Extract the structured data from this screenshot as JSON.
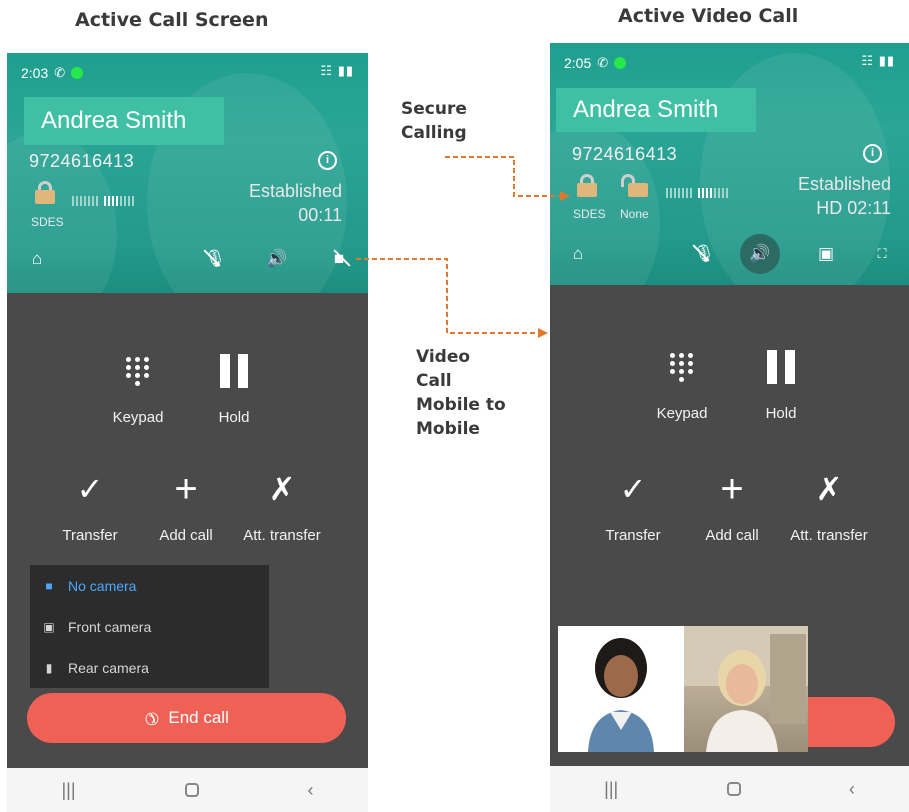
{
  "captions": {
    "left": "Active Call Screen",
    "right": "Active Video Call"
  },
  "annotations": {
    "secure": [
      "Secure",
      "Calling"
    ],
    "video": [
      "Video",
      "Call",
      "Mobile to",
      "Mobile"
    ]
  },
  "colors": {
    "header_teal": "#239a8b",
    "name_box": "#3fbfa3",
    "body_gray": "#4a4a4a",
    "end_call": "#f06155",
    "arrow": "#e07a2a",
    "menu_active": "#4aa8ff"
  },
  "left_phone": {
    "status_time": "2:03",
    "contact_name": "Andrea Smith",
    "number": "9724616413",
    "call_state": "Established",
    "timer": "00:11",
    "encryption": "SDES",
    "controls": [
      "home-icon",
      "mute-icon",
      "speaker-icon",
      "video-off-icon"
    ],
    "actions": {
      "keypad": "Keypad",
      "hold": "Hold",
      "transfer": "Transfer",
      "add_call": "Add call",
      "att_transfer": "Att. transfer"
    },
    "camera_menu": {
      "no_camera": "No camera",
      "front_camera": "Front camera",
      "rear_camera": "Rear camera",
      "selected": "No camera"
    },
    "end_call": "End call"
  },
  "right_phone": {
    "status_time": "2:05",
    "contact_name": "Andrea Smith",
    "number": "9724616413",
    "call_state": "Established",
    "timer": "HD  02:11",
    "encryption": "SDES",
    "encryption_alt": "None",
    "controls": [
      "home-icon",
      "mute-icon",
      "speaker-icon",
      "camera-switch-icon",
      "fullscreen-icon"
    ],
    "actions": {
      "keypad": "Keypad",
      "hold": "Hold",
      "transfer": "Transfer",
      "add_call": "Add call",
      "att_transfer": "Att. transfer"
    }
  }
}
